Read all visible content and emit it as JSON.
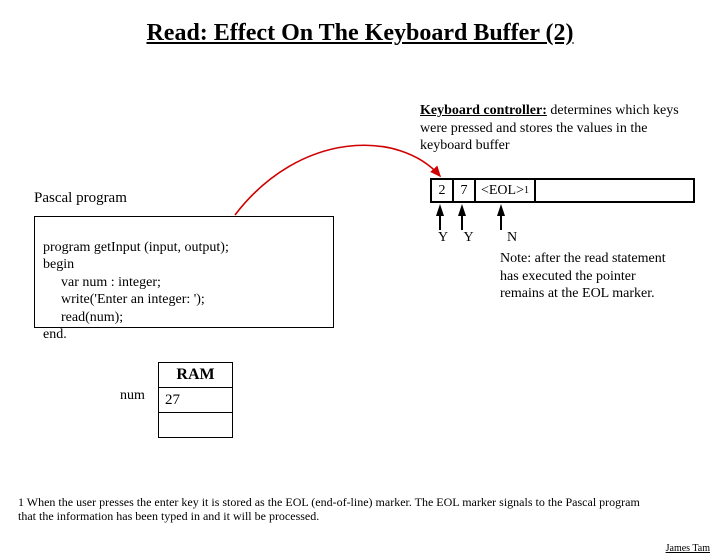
{
  "title": "Read: Effect On The Keyboard Buffer (2)",
  "keyboard_controller": {
    "label": "Keyboard controller:",
    "desc": " determines which keys were pressed and stores the values in the keyboard buffer"
  },
  "buffer": {
    "cell1": "2",
    "cell2": "7",
    "eol": "<EOL>",
    "eol_sup": "1"
  },
  "arrows": {
    "y1": "Y",
    "y2": "Y",
    "n": "N"
  },
  "note": "Note: after the read statement has executed the pointer remains at the EOL marker.",
  "pascal": {
    "label": "Pascal program",
    "l1": "program getInput (input, output);",
    "l2": "begin",
    "l3": "var num : integer;",
    "l4": "write('Enter an integer: ');",
    "l5": "read(num);",
    "l6": "end."
  },
  "ram": {
    "header": "RAM",
    "rowlabel": "num",
    "value": "27"
  },
  "footnote": "1 When the user presses the enter key it is stored as the EOL (end-of-line) marker. The EOL marker signals to the Pascal program that the information has been typed in and it will be processed.",
  "author": "James Tam"
}
